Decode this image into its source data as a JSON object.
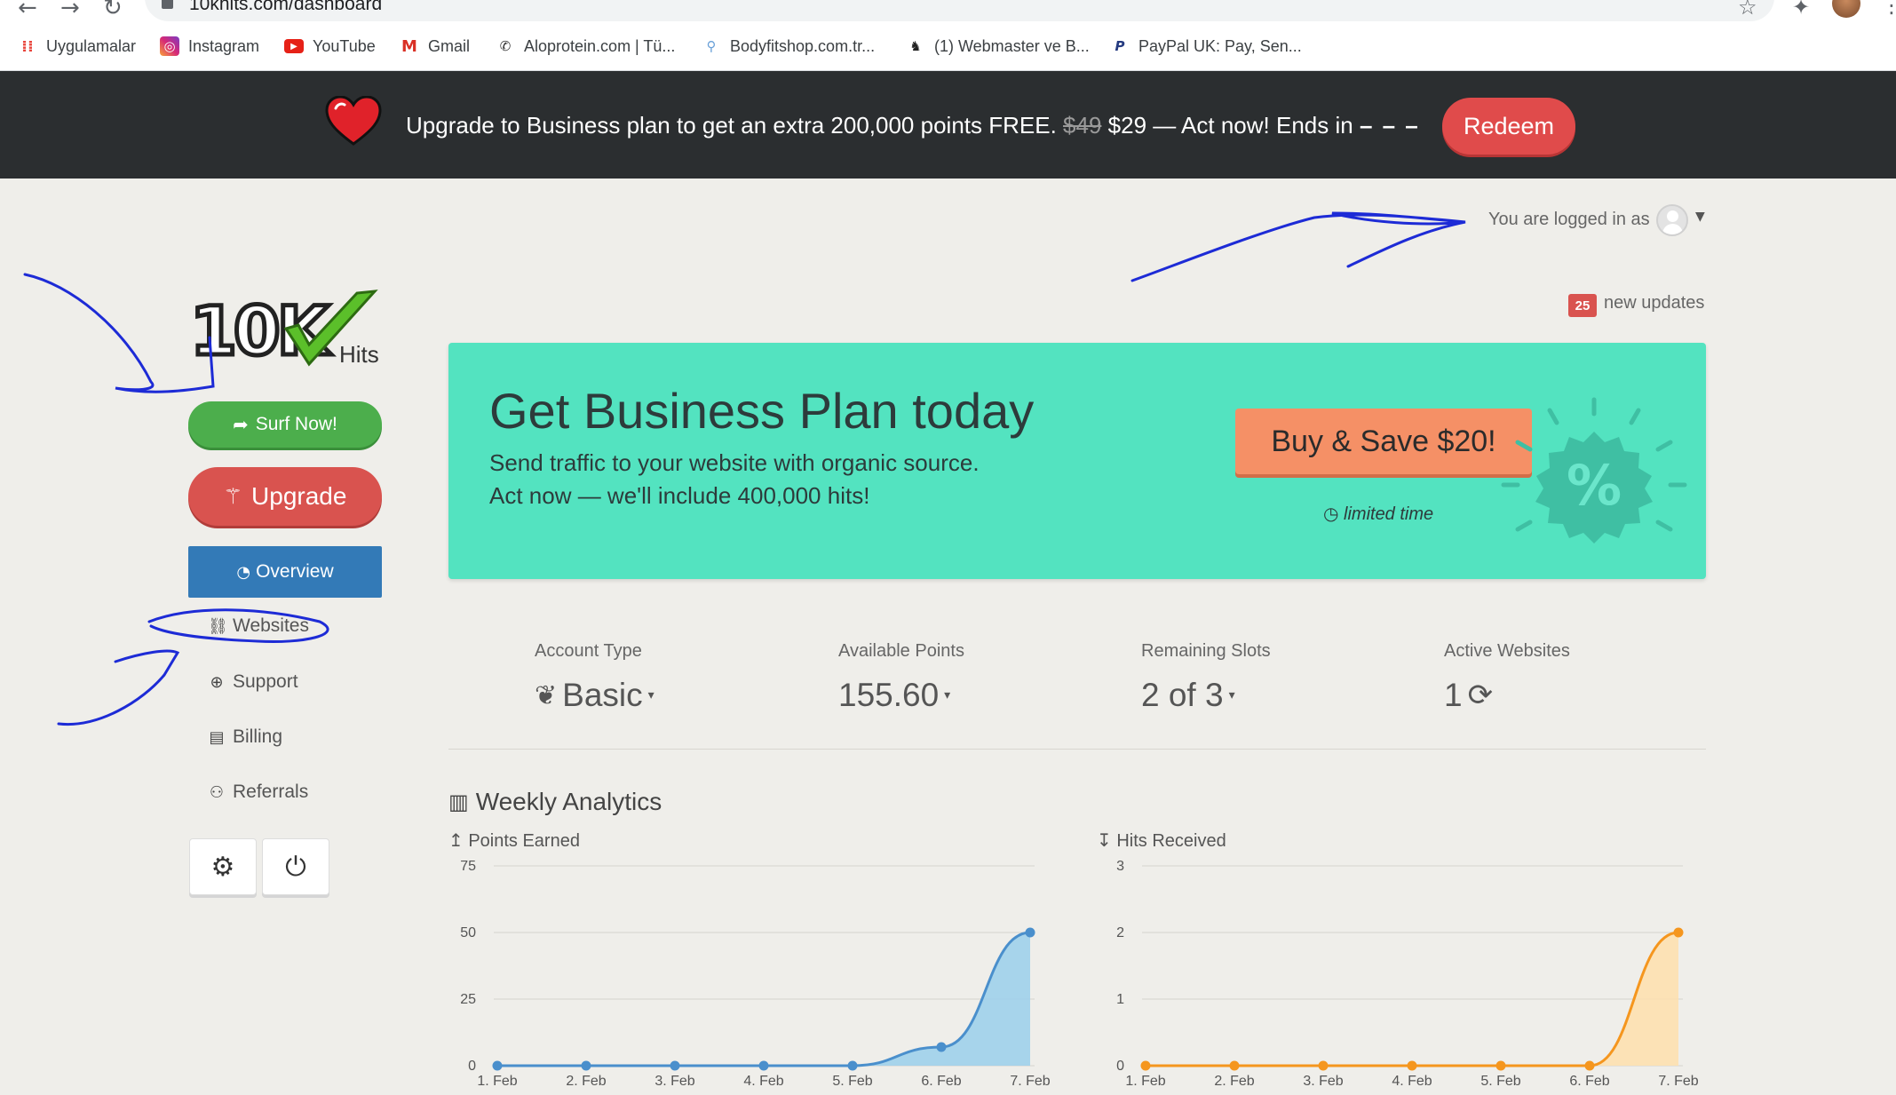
{
  "browser": {
    "url": "10khits.com/dashboard",
    "bookmarks": [
      {
        "label": "Uygulamalar",
        "icon": "apps-grid-icon"
      },
      {
        "label": "Instagram",
        "icon": "instagram-icon"
      },
      {
        "label": "YouTube",
        "icon": "youtube-icon"
      },
      {
        "label": "Gmail",
        "icon": "gmail-icon"
      },
      {
        "label": "Aloprotein.com | Tü...",
        "icon": "site-favicon"
      },
      {
        "label": "Bodyfitshop.com.tr...",
        "icon": "site-favicon"
      },
      {
        "label": "(1) Webmaster ve B...",
        "icon": "site-favicon"
      },
      {
        "label": "PayPal UK: Pay, Sen...",
        "icon": "paypal-icon"
      }
    ]
  },
  "promo_banner": {
    "text_before": "Upgrade to Business plan to get an extra 200,000 points FREE.",
    "old_price": "$49",
    "text_after": "$29 — Act now! Ends in",
    "timer": "– – –",
    "button": "Redeem"
  },
  "header": {
    "logged_in_text": "You are logged in as",
    "updates_count": "25",
    "updates_text": "new updates"
  },
  "sidebar": {
    "logo_text": "10K",
    "logo_sub": "Hits",
    "surf_button": "Surf Now!",
    "upgrade_button": "Upgrade",
    "nav": [
      {
        "label": "Overview",
        "icon": "dashboard-icon",
        "active": true
      },
      {
        "label": "Websites",
        "icon": "link-icon"
      },
      {
        "label": "Support",
        "icon": "lifebuoy-icon"
      },
      {
        "label": "Billing",
        "icon": "credit-card-icon"
      },
      {
        "label": "Referrals",
        "icon": "users-icon"
      }
    ],
    "settings_icon": "gear-icon",
    "logout_icon": "power-icon"
  },
  "business_card": {
    "title": "Get Business Plan today",
    "line1": "Send traffic to your website with organic source.",
    "line2": "Act now — we'll include 400,000 hits!",
    "button": "Buy & Save $20!",
    "limited": "limited time",
    "badge_symbol": "%"
  },
  "stats": [
    {
      "label": "Account Type",
      "value": "Basic",
      "icon": "leaf-icon"
    },
    {
      "label": "Available Points",
      "value": "155.60"
    },
    {
      "label": "Remaining Slots",
      "value": "2 of 3"
    },
    {
      "label": "Active Websites",
      "value": "1",
      "icon": "refresh-icon"
    }
  ],
  "analytics": {
    "title": "Weekly Analytics",
    "colors": {
      "points": "#4a8fcc",
      "hits": "#f5961e"
    }
  },
  "chart_data": [
    {
      "type": "area",
      "title": "Points Earned",
      "categories": [
        "1. Feb",
        "2. Feb",
        "3. Feb",
        "4. Feb",
        "5. Feb",
        "6. Feb",
        "7. Feb"
      ],
      "values": [
        0,
        0,
        0,
        0,
        0,
        7,
        50
      ],
      "ylim": [
        0,
        75
      ],
      "yticks": [
        0,
        25,
        50,
        75
      ],
      "grid": true
    },
    {
      "type": "area",
      "title": "Hits Received",
      "categories": [
        "1. Feb",
        "2. Feb",
        "3. Feb",
        "4. Feb",
        "5. Feb",
        "6. Feb",
        "7. Feb"
      ],
      "values": [
        0,
        0,
        0,
        0,
        0,
        0,
        2
      ],
      "ylim": [
        0,
        3
      ],
      "yticks": [
        0,
        1,
        2,
        3
      ],
      "grid": true
    }
  ]
}
